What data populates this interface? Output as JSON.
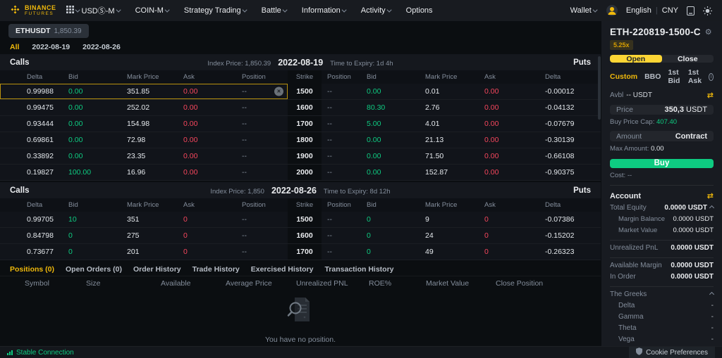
{
  "colors": {
    "accent": "#f0b90b",
    "green": "#0ecb81",
    "red": "#f6465d",
    "bg": "#0b0e11",
    "panel": "#181b21"
  },
  "topnav": {
    "brand": {
      "line1": "BINANCE",
      "line2": "FUTURES"
    },
    "menus": [
      {
        "label": "USDⓈ-M",
        "caret": true
      },
      {
        "label": "COIN-M",
        "caret": true
      },
      {
        "label": "Strategy Trading",
        "caret": true
      },
      {
        "label": "Battle",
        "caret": true
      },
      {
        "label": "Information",
        "caret": true
      },
      {
        "label": "Activity",
        "caret": true
      },
      {
        "label": "Options",
        "caret": false
      }
    ],
    "right": {
      "wallet_label": "Wallet",
      "language": "English",
      "currency": "CNY"
    }
  },
  "symbol_tab": {
    "symbol": "ETHUSDT",
    "price": "1,850.39"
  },
  "date_tabs": [
    {
      "label": "All",
      "active": true
    },
    {
      "label": "2022-08-19",
      "active": false
    },
    {
      "label": "2022-08-26",
      "active": false
    }
  ],
  "chain_headers": [
    "Delta",
    "Bid",
    "Mark Price",
    "Ask",
    "Position",
    "Strike",
    "Position",
    "Bid",
    "Mark Price",
    "Ask",
    "Delta"
  ],
  "chains": [
    {
      "calls_label": "Calls",
      "puts_label": "Puts",
      "index_price": "Index Price: 1,850.39",
      "date": "2022-08-19",
      "expiry": "Time to Expiry: 1d 4h",
      "rows": [
        {
          "selected": true,
          "call": [
            "0.99988",
            "0.00",
            "351.85",
            "0.00",
            "--"
          ],
          "strike": "1500",
          "put": [
            "--",
            "0.00",
            "0.01",
            "0.00",
            "-0.00012"
          ]
        },
        {
          "selected": false,
          "call": [
            "0.99475",
            "0.00",
            "252.02",
            "0.00",
            "--"
          ],
          "strike": "1600",
          "put": [
            "--",
            "80.30",
            "2.76",
            "0.00",
            "-0.04132"
          ]
        },
        {
          "selected": false,
          "call": [
            "0.93444",
            "0.00",
            "154.98",
            "0.00",
            "--"
          ],
          "strike": "1700",
          "put": [
            "--",
            "5.00",
            "4.01",
            "0.00",
            "-0.07679"
          ]
        },
        {
          "selected": false,
          "call": [
            "0.69861",
            "0.00",
            "72.98",
            "0.00",
            "--"
          ],
          "strike": "1800",
          "put": [
            "--",
            "0.00",
            "21.13",
            "0.00",
            "-0.30139"
          ]
        },
        {
          "selected": false,
          "call": [
            "0.33892",
            "0.00",
            "23.35",
            "0.00",
            "--"
          ],
          "strike": "1900",
          "put": [
            "--",
            "0.00",
            "71.50",
            "0.00",
            "-0.66108"
          ]
        },
        {
          "selected": false,
          "call": [
            "0.19827",
            "100.00",
            "16.96",
            "0.00",
            "--"
          ],
          "strike": "2000",
          "put": [
            "--",
            "0.00",
            "152.87",
            "0.00",
            "-0.90375"
          ]
        }
      ]
    },
    {
      "calls_label": "Calls",
      "puts_label": "Puts",
      "index_price": "Index Price: 1,850",
      "date": "2022-08-26",
      "expiry": "Time to Expiry: 8d 12h",
      "rows": [
        {
          "selected": false,
          "call": [
            "0.99705",
            "10",
            "351",
            "0",
            "--"
          ],
          "strike": "1500",
          "put": [
            "--",
            "0",
            "9",
            "0",
            "-0.07386"
          ]
        },
        {
          "selected": false,
          "call": [
            "0.84798",
            "0",
            "275",
            "0",
            "--"
          ],
          "strike": "1600",
          "put": [
            "--",
            "0",
            "24",
            "0",
            "-0.15202"
          ]
        },
        {
          "selected": false,
          "call": [
            "0.73677",
            "0",
            "201",
            "0",
            "--"
          ],
          "strike": "1700",
          "put": [
            "--",
            "0",
            "49",
            "0",
            "-0.26323"
          ]
        }
      ]
    }
  ],
  "positions_panel": {
    "tabs": [
      {
        "label": "Positions (0)",
        "active": true
      },
      {
        "label": "Open Orders (0)",
        "active": false
      },
      {
        "label": "Order History",
        "active": false
      },
      {
        "label": "Trade History",
        "active": false
      },
      {
        "label": "Exercised History",
        "active": false
      },
      {
        "label": "Transaction History",
        "active": false
      }
    ],
    "headers": [
      "Symbol",
      "Size",
      "Available",
      "Average Price",
      "Unrealized PNL",
      "ROE%",
      "Market Value",
      "Close Position"
    ],
    "empty_text": "You have no position."
  },
  "order_panel": {
    "title": "ETH-220819-1500-C",
    "leverage_badge": "5.25x",
    "side_tabs": [
      {
        "label": "Open",
        "active": true
      },
      {
        "label": "Close",
        "active": false
      }
    ],
    "order_types": [
      {
        "label": "Custom",
        "active": true
      },
      {
        "label": "BBO",
        "active": false
      },
      {
        "label": "1st Bid",
        "active": false
      },
      {
        "label": "1st Ask",
        "active": false
      }
    ],
    "avbl_label": "Avbl",
    "avbl_value": "-- USDT",
    "price_field": {
      "label": "Price",
      "value": "350,3",
      "unit": "USDT"
    },
    "buy_price_cap_label": "Buy Price Cap:",
    "buy_price_cap_value": "407.40",
    "amount_field": {
      "placeholder": "Amount",
      "unit": "Contract"
    },
    "max_amount_label": "Max Amount:",
    "max_amount_value": "0.00",
    "buy_label": "Buy",
    "cost_label": "Cost:",
    "cost_value": "--",
    "account": {
      "title": "Account",
      "equity_rows": [
        {
          "label": "Total Equity",
          "value": "0.0000 USDT",
          "indent": false,
          "caret": true
        },
        {
          "label": "Margin Balance",
          "value": "0.0000 USDT",
          "indent": true,
          "caret": false
        },
        {
          "label": "Market Value",
          "value": "0.0000 USDT",
          "indent": true,
          "caret": false
        }
      ],
      "unrealized": {
        "label": "Unrealized PnL",
        "value": "0.0000 USDT"
      },
      "margin_rows": [
        {
          "label": "Available Margin",
          "value": "0.0000 USDT"
        },
        {
          "label": "In Order",
          "value": "0.0000 USDT"
        }
      ]
    },
    "greeks": {
      "title": "The Greeks",
      "rows": [
        {
          "label": "Delta",
          "value": "-"
        },
        {
          "label": "Gamma",
          "value": "-"
        },
        {
          "label": "Theta",
          "value": "-"
        },
        {
          "label": "Vega",
          "value": "-"
        }
      ]
    }
  },
  "statusbar": {
    "connection": "Stable Connection",
    "cookie_label": "Cookie Preferences"
  }
}
